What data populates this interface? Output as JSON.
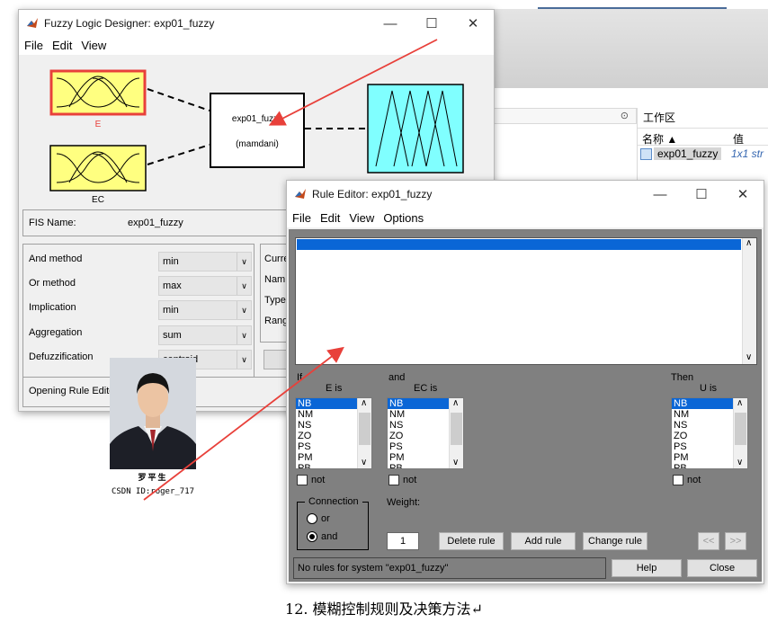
{
  "matlab_bg": {
    "workspace_title": "工作区",
    "col_name": "名称 ▲",
    "col_value": "值",
    "var_name": "exp01_fuzzy",
    "var_value": "1x1 str"
  },
  "fld": {
    "title": "Fuzzy Logic Designer: exp01_fuzzy",
    "menus": [
      "File",
      "Edit",
      "View"
    ],
    "input1": "E",
    "input2": "EC",
    "system_name": "exp01_fuzzy",
    "system_type": "(mamdani)",
    "fis_name_label": "FIS Name:",
    "fis_name": "exp01_fuzzy",
    "methods": [
      {
        "label": "And method",
        "value": "min"
      },
      {
        "label": "Or method",
        "value": "max"
      },
      {
        "label": "Implication",
        "value": "min"
      },
      {
        "label": "Aggregation",
        "value": "sum"
      },
      {
        "label": "Defuzzification",
        "value": "centroid"
      }
    ],
    "right_labels": [
      "Curre",
      "Nam",
      "Type",
      "Rang"
    ],
    "status": "Opening Rule Editor"
  },
  "photo": {
    "signature": "罗平生",
    "caption": "CSDN ID:roger_717"
  },
  "re": {
    "title": "Rule Editor: exp01_fuzzy",
    "menus": [
      "File",
      "Edit",
      "View",
      "Options"
    ],
    "if_label": "If",
    "and_label": "and",
    "then_label": "Then",
    "e_is": "E is",
    "ec_is": "EC is",
    "u_is": "U is",
    "terms": [
      "NB",
      "NM",
      "NS",
      "ZO",
      "PS",
      "PM",
      "PB"
    ],
    "not_label": "not",
    "connection_label": "Connection",
    "or_label": "or",
    "and_radio": "and",
    "weight_label": "Weight:",
    "weight_value": "1",
    "delete_rule": "Delete rule",
    "add_rule": "Add rule",
    "change_rule": "Change rule",
    "prev": "<<",
    "next": ">>",
    "status": "No rules for system \"exp01_fuzzy\"",
    "help": "Help",
    "close": "Close"
  },
  "caption": "12. 模糊控制规则及决策方法↵",
  "colors": {
    "arrow": "#e8403a",
    "input_fill": "#ffff80",
    "output_fill": "#80ffff",
    "select_blue": "#0a66d6"
  }
}
